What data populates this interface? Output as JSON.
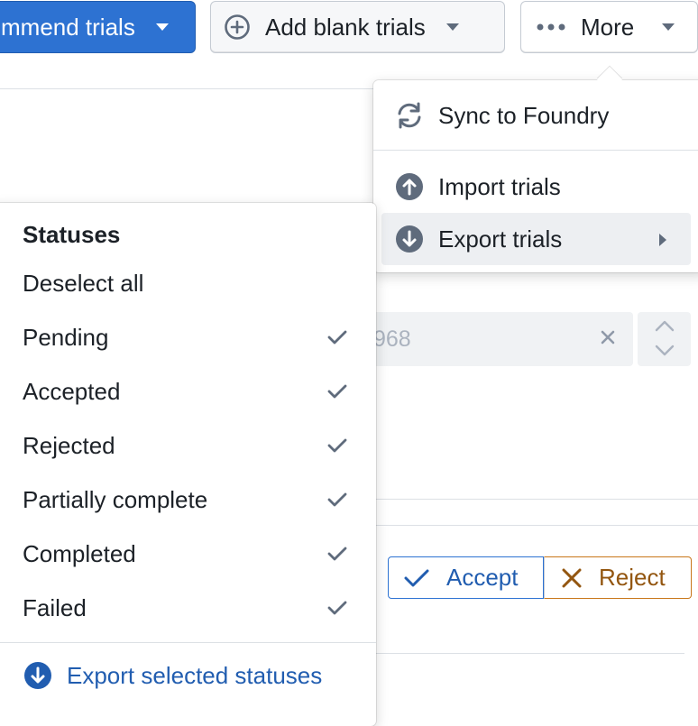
{
  "toolbar": {
    "recommend_label": "mmend trials",
    "add_blank_label": "Add blank trials",
    "more_label": "More"
  },
  "more_menu": {
    "items": [
      {
        "label": "Sync to Foundry",
        "icon": "refresh-icon"
      },
      {
        "label": "Import trials",
        "icon": "upload-icon"
      },
      {
        "label": "Export trials",
        "icon": "download-icon",
        "has_submenu": true,
        "active": true
      }
    ]
  },
  "background": {
    "numeric_input_value": "968",
    "accept_label": "Accept",
    "reject_label": "Reject"
  },
  "status_filter": {
    "heading": "Statuses",
    "deselect_label": "Deselect all",
    "statuses": [
      {
        "label": "Pending",
        "checked": true
      },
      {
        "label": "Accepted",
        "checked": true
      },
      {
        "label": "Rejected",
        "checked": true
      },
      {
        "label": "Partially complete",
        "checked": true
      },
      {
        "label": "Completed",
        "checked": true
      },
      {
        "label": "Failed",
        "checked": true
      }
    ],
    "export_label": "Export selected statuses"
  },
  "colors": {
    "primary": "#2d72d2",
    "link": "#215db0",
    "warning": "#935610",
    "icon": "#5f6b7c"
  }
}
